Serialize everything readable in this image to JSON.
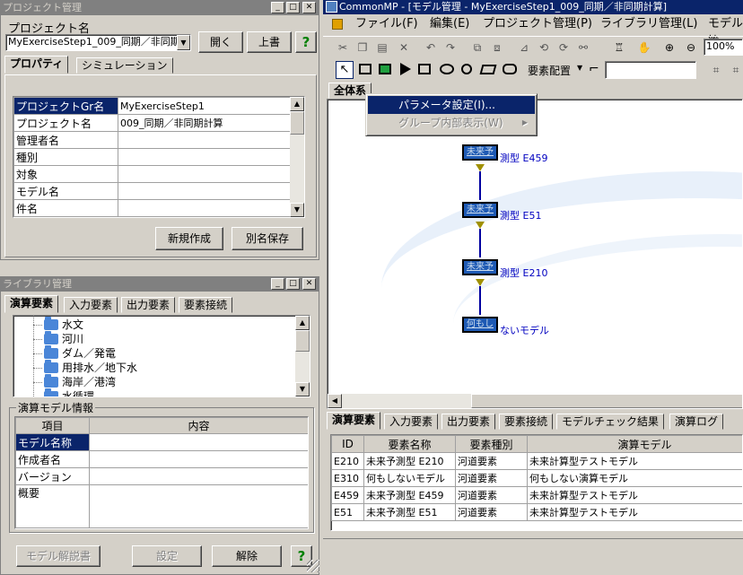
{
  "project_panel": {
    "title": "プロジェクト管理",
    "project_name_label": "プロジェクト名",
    "project_select_value": "MyExerciseStep1_009_同期／非同期",
    "open_btn": "開く",
    "overwrite_btn": "上書",
    "help": "?",
    "tabs": [
      "プロパティ",
      "シミュレーション"
    ],
    "props": [
      {
        "key": "プロジェクトGr名",
        "value": "MyExerciseStep1"
      },
      {
        "key": "プロジェクト名",
        "value": "009_同期／非同期計算"
      },
      {
        "key": "管理者名",
        "value": ""
      },
      {
        "key": "種別",
        "value": ""
      },
      {
        "key": "対象",
        "value": ""
      },
      {
        "key": "モデル名",
        "value": ""
      },
      {
        "key": "件名",
        "value": ""
      }
    ],
    "new_btn": "新規作成",
    "saveas_btn": "別名保存"
  },
  "library_panel": {
    "title": "ライブラリ管理",
    "tabs": [
      "演算要素",
      "入力要素",
      "出力要素",
      "要素接続"
    ],
    "tree": [
      "水文",
      "河川",
      "ダム／発電",
      "用排水／地下水",
      "海岸／港湾",
      "水循環"
    ],
    "info_group": "演算モデル情報",
    "info_headers": [
      "項目",
      "内容"
    ],
    "info_rows": [
      {
        "key": "モデル名称",
        "value": ""
      },
      {
        "key": "作成者名",
        "value": ""
      },
      {
        "key": "バージョン",
        "value": ""
      },
      {
        "key": "概要",
        "value": ""
      }
    ],
    "manual_btn": "モデル解説書",
    "settings_btn": "設定",
    "release_btn": "解除",
    "help": "?"
  },
  "main_window": {
    "title": "CommonMP - [モデル管理 - MyExerciseStep1_009_同期／非同期計算]",
    "menu": [
      "ファイル(F)",
      "編集(E)",
      "プロジェクト管理(P)",
      "ライブラリ管理(L)",
      "モデル管"
    ],
    "zoom": "100%",
    "arrange_label": "要素配置",
    "canvas_tab": "全体系",
    "context_menu": [
      {
        "label": "パラメータ設定(I)...",
        "enabled": true
      },
      {
        "label": "グループ内部表示(W)",
        "enabled": false
      }
    ],
    "nodes": [
      {
        "icon_text": "未来予",
        "label": "測型 E459"
      },
      {
        "icon_text": "未来予",
        "label": "測型 E51"
      },
      {
        "icon_text": "未来予",
        "label": "測型 E210"
      },
      {
        "icon_text": "何もし",
        "label": "ないモデル"
      }
    ],
    "bottom_tabs": [
      "演算要素",
      "入力要素",
      "出力要素",
      "要素接続",
      "モデルチェック結果",
      "演算ログ"
    ],
    "table_headers": [
      "ID",
      "要素名称",
      "要素種別",
      "演算モデル"
    ],
    "table_rows": [
      [
        "E210",
        "未来予測型 E210",
        "河道要素",
        "未来計算型テストモデル"
      ],
      [
        "E310",
        "何もしないモデル",
        "河道要素",
        "何もしない演算モデル"
      ],
      [
        "E459",
        "未来予測型 E459",
        "河道要素",
        "未来計算型テストモデル"
      ],
      [
        "E51",
        "未来予測型 E51",
        "河道要素",
        "未来計算型テストモデル"
      ]
    ]
  }
}
